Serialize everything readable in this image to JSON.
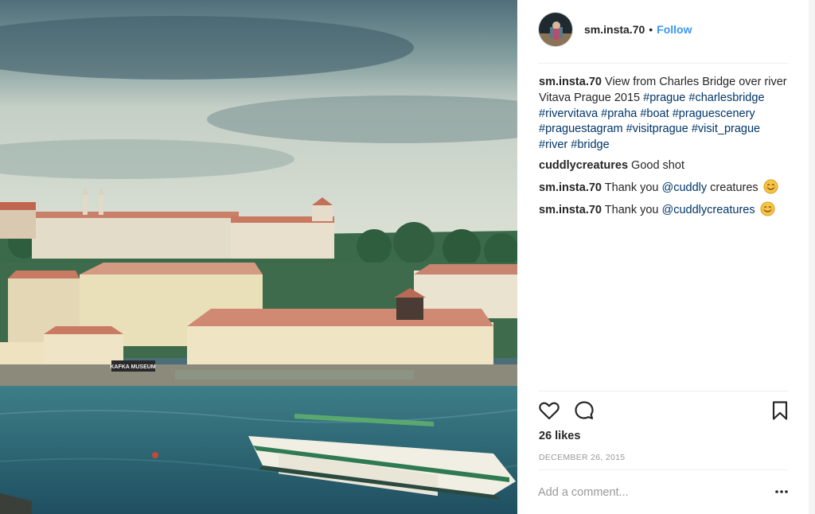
{
  "post": {
    "username": "sm.insta.70",
    "separator": "•",
    "follow_label": "Follow",
    "caption": {
      "username": "sm.insta.70",
      "text": " View from Charles Bridge over river Vitava Prague 2015 ",
      "hashtags": [
        "#prague",
        "#charlesbridge",
        "#rivervitava",
        "#praha",
        "#boat",
        "#praguescenery",
        "#praguestagram",
        "#visitprague",
        "#visit_prague",
        "#river",
        "#bridge"
      ]
    },
    "comments": [
      {
        "username": "cuddlycreatures",
        "pre": " Good shot",
        "mention": "",
        "post": "",
        "emoji": ""
      },
      {
        "username": "sm.insta.70",
        "pre": " Thank you ",
        "mention": "@cuddly",
        "post": " creatures",
        "emoji": "smiling-face-emoji"
      },
      {
        "username": "sm.insta.70",
        "pre": " Thank you ",
        "mention": "@cuddlycreatures",
        "post": "",
        "emoji": "smiling-face-emoji"
      }
    ],
    "likes_text": "26 likes",
    "date": "DECEMBER 26, 2015",
    "add_comment_placeholder": "Add a comment...",
    "photo_sign": "KAFKA MUSEUM"
  },
  "icons": {
    "like": "heart-outline-icon",
    "comment": "speech-bubble-icon",
    "save": "bookmark-icon",
    "more": "more-dots-icon"
  },
  "colors": {
    "link_blue": "#3897f0",
    "hashtag": "#003569",
    "muted": "#999999",
    "text": "#262626"
  }
}
